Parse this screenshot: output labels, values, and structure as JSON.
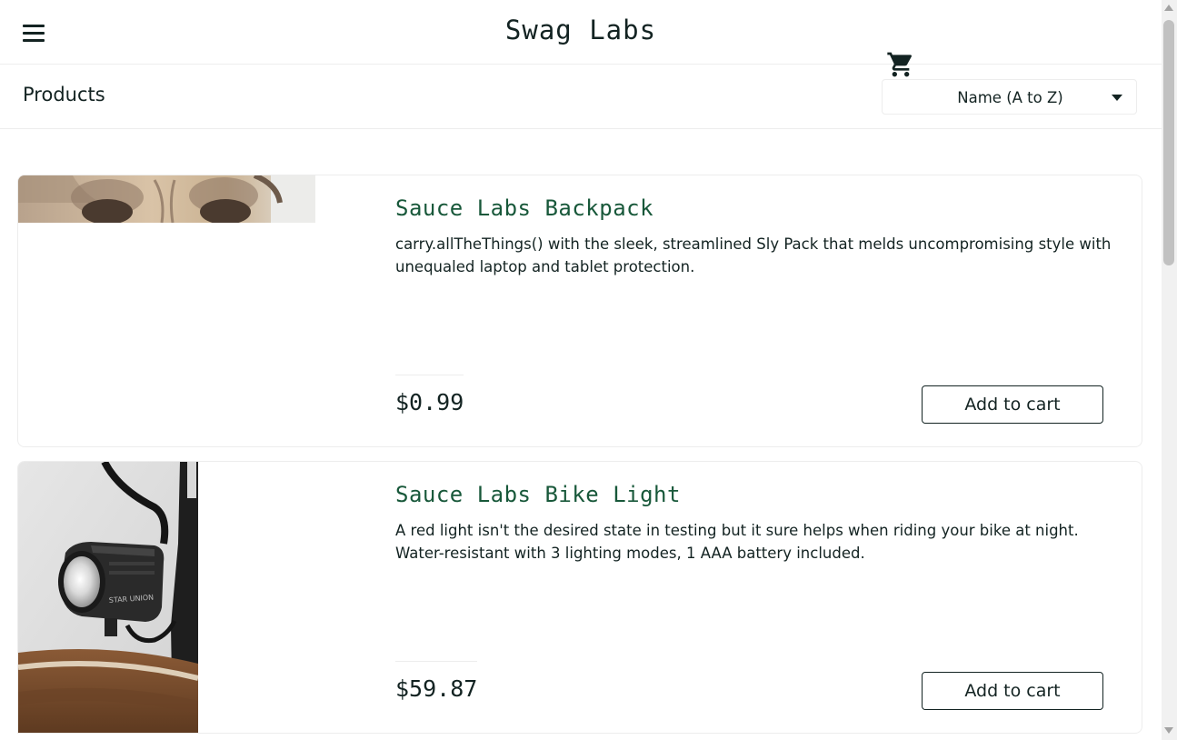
{
  "header": {
    "app_logo": "Swag Labs",
    "menu_icon": "hamburger-menu-icon",
    "cart_icon": "shopping-cart-icon"
  },
  "secondary_header": {
    "title": "Products",
    "sort": {
      "selected": "Name (A to Z)",
      "caret_icon": "caret-down-icon"
    }
  },
  "inventory": {
    "items": [
      {
        "name": "Sauce Labs Backpack",
        "description": "carry.allTheThings() with the sleek, streamlined Sly Pack that melds uncompromising style with unequaled laptop and tablet protection.",
        "price": "$0.99",
        "button_label": "Add to cart",
        "image": "pug-dog-photo"
      },
      {
        "name": "Sauce Labs Bike Light",
        "description": "A red light isn't the desired state in testing but it sure helps when riding your bike at night. Water-resistant with 3 lighting modes, 1 AAA battery included.",
        "price": "$59.87",
        "button_label": "Add to cart",
        "image": "bike-light-photo",
        "image_text": "STAR UNION"
      }
    ]
  },
  "colors": {
    "accent": "#18583a",
    "text": "#132322",
    "border": "#ededed"
  }
}
